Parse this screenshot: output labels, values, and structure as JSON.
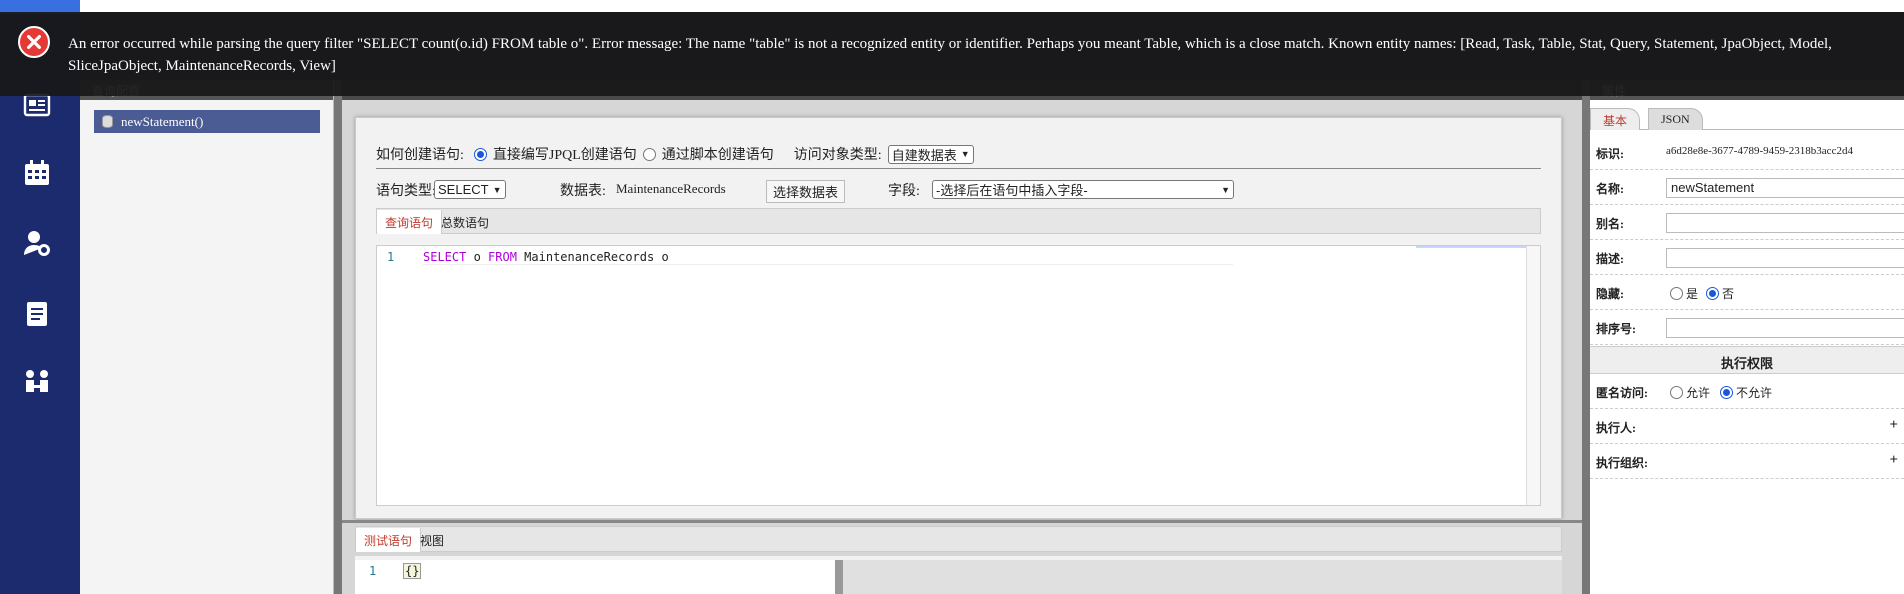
{
  "error": {
    "message": "An error occurred while parsing the query filter \"SELECT count(o.id) FROM table o\". Error message: The name \"table\" is not a recognized entity or identifier. Perhaps you meant Table, which is a close match. Known entity names: [Read, Task, Table, Stat, Query, Statement, JpaObject, Model, SliceJpaObject, MaintenanceRecords, View]"
  },
  "sidebar": {
    "icons": [
      "news-icon",
      "calendar-icon",
      "user-settings-icon",
      "clipboard-icon",
      "team-icon"
    ]
  },
  "config_panel": {
    "title": "查询配置",
    "tree": [
      {
        "label": "newStatement()"
      }
    ]
  },
  "editor": {
    "create_label": "如何创建语句:",
    "create_opt1": "直接编写JPQL创建语句",
    "create_opt2": "通过脚本创建语句",
    "create_selected": 1,
    "access_type_label": "访问对象类型:",
    "access_type_value": "自建数据表",
    "stmt_type_label": "语句类型:",
    "stmt_type_value": "SELECT",
    "table_label": "数据表:",
    "table_value": "MaintenanceRecords",
    "choose_table_btn": "选择数据表",
    "field_label": "字段:",
    "field_value": "-选择后在语句中插入字段-",
    "tabs": [
      "查询语句",
      "总数语句"
    ],
    "active_tab": 0,
    "code_line_no": "1",
    "code": {
      "kw1": "SELECT",
      "t1": " o ",
      "kw2": "FROM",
      "t2": " MaintenanceRecords o"
    }
  },
  "test_panel": {
    "tabs": [
      "测试语句",
      "视图"
    ],
    "active_tab": 0,
    "line_no": "1",
    "code": "{}"
  },
  "properties": {
    "title": "属性",
    "tabs": [
      "基本",
      "JSON"
    ],
    "active_tab": 0,
    "id_label": "标识:",
    "id_value": "a6d28e8e-3677-4789-9459-2318b3acc2d4",
    "name_label": "名称:",
    "name_value": "newStatement",
    "alias_label": "别名:",
    "desc_label": "描述:",
    "hidden_label": "隐藏:",
    "hidden_yes": "是",
    "hidden_no": "否",
    "hidden_selected": "否",
    "order_label": "排序号:",
    "perm_section": "执行权限",
    "anon_label": "匿名访问:",
    "anon_allow": "允许",
    "anon_deny": "不允许",
    "anon_selected": "不允许",
    "executor_label": "执行人:",
    "executor_org_label": "执行组织:",
    "plus": "+"
  }
}
